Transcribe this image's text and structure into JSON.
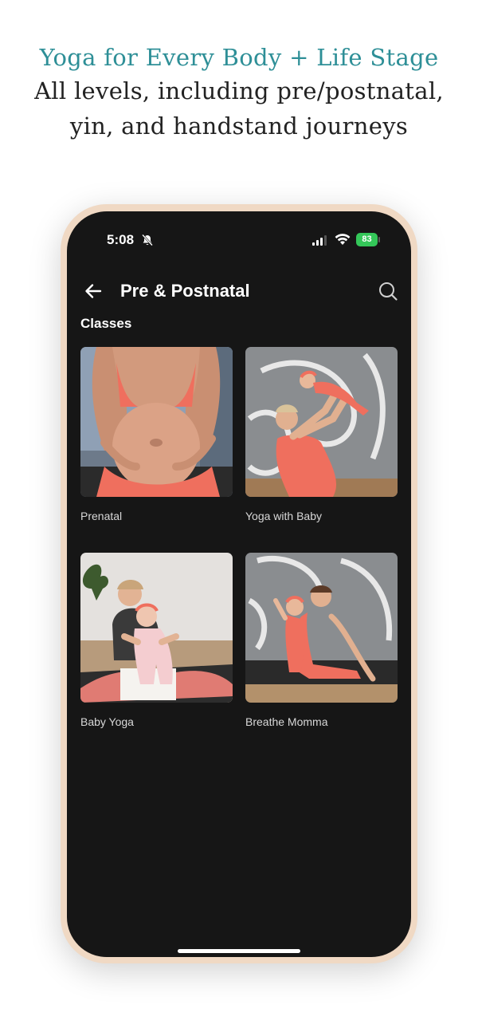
{
  "promo": {
    "headline": "Yoga for Every Body + Life Stage",
    "subline_1": "All levels, including pre/postnatal,",
    "subline_2": "yin, and handstand journeys"
  },
  "status_bar": {
    "time": "5:08",
    "battery": "83"
  },
  "nav": {
    "title": "Pre & Postnatal"
  },
  "section": {
    "title": "Classes"
  },
  "classes": [
    {
      "label": "Prenatal"
    },
    {
      "label": "Yoga with Baby"
    },
    {
      "label": "Baby Yoga"
    },
    {
      "label": "Breathe Momma"
    }
  ],
  "colors": {
    "accent_teal": "#2e8f97",
    "screen_bg": "#161616",
    "frame": "#f0d9c4",
    "outfit_coral": "#ef6f5e",
    "battery_green": "#34c759"
  },
  "icons": {
    "back": "arrow-left-icon",
    "search": "search-icon",
    "silent": "bell-slash-icon",
    "signal": "cellular-signal-icon",
    "wifi": "wifi-icon"
  }
}
